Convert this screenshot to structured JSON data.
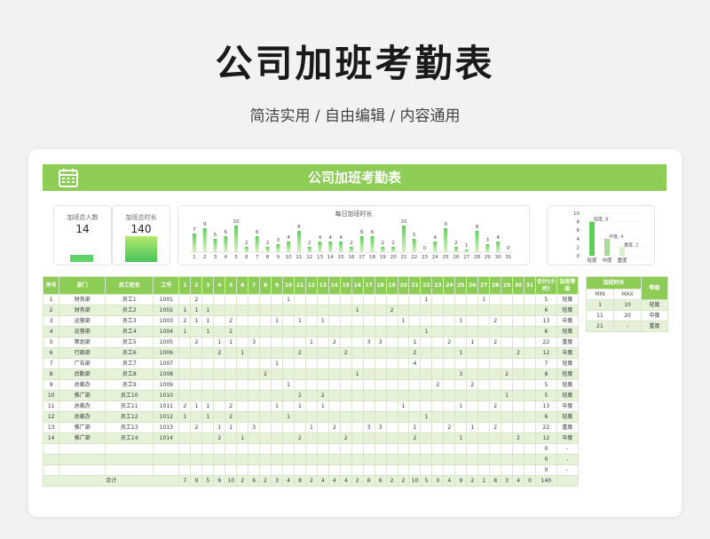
{
  "header": {
    "title": "公司加班考勤表",
    "subtitle": "简洁实用 / 自由编辑 / 内容通用"
  },
  "sheet": {
    "title": "公司加班考勤表"
  },
  "stats": [
    {
      "label": "加班总人数",
      "value": "14"
    },
    {
      "label": "加班总时长",
      "value": "140"
    }
  ],
  "daily_panel_title": "每日加班时长",
  "colors": {
    "accent": "#8dcc55",
    "alt_row": "#e5f2d9"
  },
  "table": {
    "headers": {
      "seq": "序号",
      "dept": "部门",
      "name": "员工姓名",
      "id": "工号",
      "total": "合计(小时)",
      "level": "加班等级"
    },
    "days": [
      "1",
      "2",
      "3",
      "4",
      "5",
      "6",
      "7",
      "8",
      "9",
      "10",
      "11",
      "12",
      "13",
      "14",
      "15",
      "16",
      "17",
      "18",
      "19",
      "20",
      "21",
      "22",
      "23",
      "24",
      "25",
      "26",
      "27",
      "28",
      "29",
      "30",
      "31"
    ],
    "rows": [
      {
        "seq": "1",
        "dept": "财务部",
        "name": "员工1",
        "id": "1001",
        "hours": [
          "",
          "2",
          "",
          "",
          "",
          "",
          "",
          "",
          "",
          "1",
          "",
          "",
          "",
          "",
          "",
          "",
          "",
          "",
          "",
          "",
          "",
          "1",
          "",
          "",
          "",
          "",
          "1",
          "",
          "",
          "",
          "",
          "",
          ""
        ],
        "total": "5",
        "level": "轻度"
      },
      {
        "seq": "2",
        "dept": "财务部",
        "name": "员工2",
        "id": "1002",
        "hours": [
          "1",
          "1",
          "1",
          "",
          "",
          "",
          "",
          "",
          "",
          "",
          "",
          "",
          "",
          "",
          "",
          "1",
          "",
          "",
          "2",
          "",
          "",
          "",
          "",
          "",
          "",
          "",
          "",
          "",
          "",
          "",
          ""
        ],
        "total": "6",
        "level": "轻度"
      },
      {
        "seq": "3",
        "dept": "运营部",
        "name": "员工3",
        "id": "1003",
        "hours": [
          "2",
          "1",
          "1",
          "",
          "2",
          "",
          "",
          "",
          "1",
          "",
          "1",
          "",
          "1",
          "",
          "",
          "",
          "",
          "",
          "",
          "1",
          "",
          "",
          "",
          "",
          "1",
          "",
          "",
          "2",
          "",
          "",
          ""
        ],
        "total": "13",
        "level": "中度"
      },
      {
        "seq": "4",
        "dept": "运营部",
        "name": "员工4",
        "id": "1004",
        "hours": [
          "1",
          "",
          "1",
          "",
          "2",
          "",
          "",
          "",
          "",
          "",
          "",
          "",
          "",
          "",
          "",
          "",
          "",
          "",
          "",
          "",
          "",
          "1",
          "",
          "",
          "",
          "",
          "",
          "",
          "",
          "",
          ""
        ],
        "total": "6",
        "level": "轻度"
      },
      {
        "seq": "5",
        "dept": "策划部",
        "name": "员工5",
        "id": "1005",
        "hours": [
          "",
          "2",
          "",
          "1",
          "1",
          "",
          "3",
          "",
          "",
          "",
          "",
          "1",
          "",
          "2",
          "",
          "",
          "3",
          "3",
          "",
          "",
          "1",
          "",
          "",
          "2",
          "",
          "1",
          "",
          "2",
          "",
          "",
          ""
        ],
        "total": "22",
        "level": "重度"
      },
      {
        "seq": "6",
        "dept": "行政部",
        "name": "员工6",
        "id": "1006",
        "hours": [
          "",
          "",
          "",
          "2",
          "",
          "1",
          "",
          "",
          "",
          "",
          "2",
          "",
          "",
          "",
          "2",
          "",
          "",
          "",
          "",
          "",
          "2",
          "",
          "",
          "",
          "1",
          "",
          "",
          "",
          "",
          "2",
          ""
        ],
        "total": "12",
        "level": "中度"
      },
      {
        "seq": "7",
        "dept": "广告部",
        "name": "员工7",
        "id": "1007",
        "hours": [
          "",
          "",
          "",
          "",
          "",
          "",
          "",
          "",
          "1",
          "",
          "",
          "",
          "",
          "",
          "",
          "",
          "",
          "",
          "",
          "",
          "4",
          "",
          "",
          "",
          "",
          "",
          "",
          "",
          "",
          "",
          ""
        ],
        "total": "7",
        "level": "轻度"
      },
      {
        "seq": "8",
        "dept": "后勤部",
        "name": "员工8",
        "id": "1008",
        "hours": [
          "",
          "",
          "",
          "",
          "",
          "",
          "",
          "2",
          "",
          "",
          "",
          "",
          "",
          "",
          "",
          "1",
          "",
          "",
          "",
          "",
          "",
          "",
          "",
          "",
          "3",
          "",
          "",
          "",
          "2",
          "",
          ""
        ],
        "total": "8",
        "level": "轻度"
      },
      {
        "seq": "9",
        "dept": "总裁办",
        "name": "员工9",
        "id": "1009",
        "hours": [
          "",
          "",
          "",
          "",
          "",
          "",
          "",
          "",
          "",
          "1",
          "",
          "",
          "",
          "",
          "",
          "",
          "",
          "",
          "",
          "",
          "",
          "",
          "2",
          "",
          "",
          "2",
          "",
          "",
          "",
          "",
          ""
        ],
        "total": "5",
        "level": "轻度"
      },
      {
        "seq": "10",
        "dept": "推广部",
        "name": "员工10",
        "id": "1010",
        "hours": [
          "",
          "",
          "",
          "",
          "",
          "",
          "",
          "",
          "",
          "",
          "2",
          "",
          "2",
          "",
          "",
          "",
          "",
          "",
          "",
          "",
          "",
          "",
          "",
          "",
          "",
          "",
          "",
          "",
          "1",
          "",
          ""
        ],
        "total": "5",
        "level": "轻度"
      },
      {
        "seq": "11",
        "dept": "总裁办",
        "name": "员工11",
        "id": "1011",
        "hours": [
          "2",
          "1",
          "1",
          "",
          "2",
          "",
          "",
          "",
          "1",
          "",
          "1",
          "",
          "1",
          "",
          "",
          "",
          "",
          "",
          "",
          "1",
          "",
          "",
          "",
          "",
          "1",
          "",
          "",
          "2",
          "",
          "",
          ""
        ],
        "total": "13",
        "level": "中度"
      },
      {
        "seq": "12",
        "dept": "总裁办",
        "name": "员工12",
        "id": "1012",
        "hours": [
          "1",
          "",
          "1",
          "",
          "2",
          "",
          "",
          "",
          "",
          "1",
          "",
          "",
          "",
          "",
          "",
          "",
          "",
          "",
          "",
          "",
          "",
          "1",
          "",
          "",
          "",
          "",
          "",
          "",
          "",
          "",
          ""
        ],
        "total": "6",
        "level": "轻度"
      },
      {
        "seq": "13",
        "dept": "推广部",
        "name": "员工13",
        "id": "1013",
        "hours": [
          "",
          "2",
          "",
          "1",
          "1",
          "",
          "3",
          "",
          "",
          "",
          "",
          "1",
          "",
          "2",
          "",
          "",
          "3",
          "3",
          "",
          "",
          "1",
          "",
          "",
          "2",
          "",
          "1",
          "",
          "2",
          "",
          "",
          ""
        ],
        "total": "22",
        "level": "重度"
      },
      {
        "seq": "14",
        "dept": "推广部",
        "name": "员工14",
        "id": "1014",
        "hours": [
          "",
          "",
          "",
          "2",
          "",
          "1",
          "",
          "",
          "",
          "",
          "2",
          "",
          "",
          "",
          "2",
          "",
          "",
          "",
          "",
          "",
          "2",
          "",
          "",
          "",
          "1",
          "",
          "",
          "",
          "",
          "2",
          ""
        ],
        "total": "12",
        "level": "中度"
      }
    ],
    "empty_rows": [
      {
        "total": "0",
        "level": "-"
      },
      {
        "total": "0",
        "level": "-"
      },
      {
        "total": "0",
        "level": "-"
      }
    ],
    "totals": {
      "label": "合计",
      "days": [
        "7",
        "9",
        "5",
        "6",
        "10",
        "2",
        "6",
        "2",
        "3",
        "4",
        "8",
        "2",
        "4",
        "4",
        "4",
        "2",
        "6",
        "6",
        "2",
        "2",
        "10",
        "5",
        "0",
        "4",
        "9",
        "2",
        "1",
        "8",
        "3",
        "4",
        "0"
      ],
      "total": "140"
    }
  },
  "level_panel": {
    "title": "加班时长",
    "level_header": "等级",
    "min_label": "MIN",
    "max_label": "MAX",
    "rows": [
      {
        "min": "1",
        "max": "10",
        "level": "轻度"
      },
      {
        "min": "11",
        "max": "20",
        "level": "中度"
      },
      {
        "min": "21",
        "max": "-",
        "level": "重度"
      }
    ]
  },
  "chart_data": [
    {
      "type": "bar",
      "title": "每日加班时长",
      "categories": [
        "1",
        "2",
        "3",
        "4",
        "5",
        "6",
        "7",
        "8",
        "9",
        "10",
        "11",
        "12",
        "13",
        "14",
        "15",
        "16",
        "17",
        "18",
        "19",
        "20",
        "21",
        "22",
        "23",
        "24",
        "25",
        "26",
        "27",
        "28",
        "29",
        "30",
        "31"
      ],
      "values": [
        7,
        9,
        5,
        6,
        10,
        2,
        6,
        2,
        3,
        4,
        8,
        2,
        4,
        4,
        4,
        2,
        6,
        6,
        2,
        2,
        10,
        5,
        0,
        4,
        9,
        2,
        1,
        8,
        3,
        4,
        0
      ],
      "ylim": [
        0,
        10
      ]
    },
    {
      "type": "bar",
      "categories": [
        "轻度",
        "中度",
        "重度"
      ],
      "values": [
        8,
        4,
        2
      ],
      "yticks": [
        "10",
        "8",
        "6",
        "4",
        "2",
        "0"
      ],
      "data_labels": [
        "轻度, 8",
        "中度, 4",
        "重度, 2"
      ],
      "ylim": [
        0,
        10
      ]
    }
  ]
}
